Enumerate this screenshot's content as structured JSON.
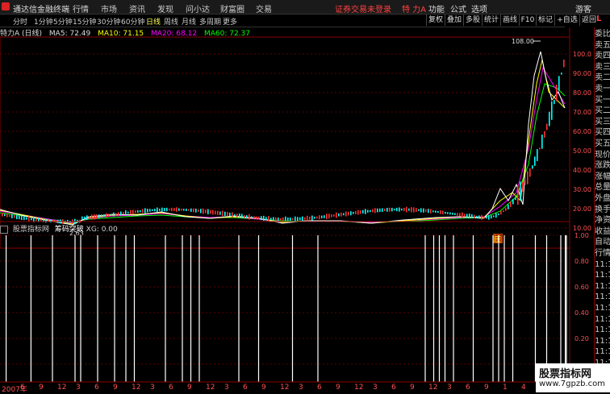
{
  "app": {
    "title": "通达信金融终端",
    "menu": [
      "行情",
      "市场",
      "资讯",
      "发现",
      "问小达",
      "财富圈",
      "交易"
    ],
    "login_warning": "证券交易未登录",
    "stock_name": "特 力A",
    "right_menu": [
      "功能",
      "公式",
      "选项",
      "游客"
    ]
  },
  "period_tabs": [
    "分时",
    "1分钟",
    "5分钟",
    "15分钟",
    "30分钟",
    "60分钟",
    "日线",
    "周线",
    "月线",
    "多周期",
    "更多"
  ],
  "active_period": "日线",
  "right_tools": [
    "复权",
    "叠加",
    "多股",
    "统计",
    "画线",
    "F10",
    "标记",
    "+自选",
    "返回"
  ],
  "info_bar": {
    "name": "特力A (日线)",
    "ma5": "MA5: 72.49",
    "ma10": "MA10: 71.15",
    "ma20": "MA20: 68.12",
    "ma60": "MA60: 72.37"
  },
  "price_axis": [
    "100.0",
    "90.00",
    "80.00",
    "70.00",
    "60.00",
    "50.00",
    "40.00",
    "30.00",
    "20.00",
    "10.00"
  ],
  "indicator_axis": [
    "1.00",
    "0.80",
    "0.60",
    "0.40",
    "0.20"
  ],
  "annotations": {
    "high": "108.00",
    "low": "2.63",
    "marker": "庄"
  },
  "indicator_info": {
    "source": "股票指标网",
    "name": "筹码突破",
    "value": "XG: 0.00"
  },
  "date_axis": [
    "2007年",
    "6",
    "9",
    "12",
    "3",
    "6",
    "9",
    "12",
    "3",
    "6",
    "9",
    "12",
    "3",
    "6",
    "9",
    "12",
    "3",
    "6",
    "9",
    "12",
    "3",
    "6",
    "9",
    "12",
    "3",
    "6",
    "9",
    "1",
    "4",
    "7"
  ],
  "right_panel": [
    "委比",
    "卖五",
    "卖四",
    "卖三",
    "卖二",
    "卖一",
    "买一",
    "买二",
    "买三",
    "买四",
    "买五",
    "现价",
    "涨跌",
    "涨幅",
    "总量",
    "外盘",
    "换手",
    "净资",
    "收益",
    "自动",
    "行情",
    "11:1",
    "11:1",
    "11:1",
    "11:1",
    "11:1",
    "11:1",
    "11:1",
    "11:1",
    "11:1",
    "11:1",
    "11:1",
    "11:1"
  ],
  "watermark": {
    "title": "股票指标网",
    "url": "www.7gpzb.com"
  },
  "signal_positions": [
    0.008,
    0.052,
    0.09,
    0.13,
    0.14,
    0.17,
    0.2,
    0.22,
    0.235,
    0.29,
    0.32,
    0.335,
    0.35,
    0.42,
    0.455,
    0.515,
    0.56,
    0.75,
    0.765,
    0.775,
    0.785,
    0.8,
    0.835,
    0.87,
    0.88,
    0.89,
    0.905,
    0.945,
    0.965,
    0.99,
    0.998,
    1.0
  ],
  "colors": {
    "ma5": "#ffffff",
    "ma10": "#ffff00",
    "ma20": "#ff00ff",
    "ma60": "#00ff00",
    "up": "#ff3030",
    "down": "#00ffff"
  }
}
